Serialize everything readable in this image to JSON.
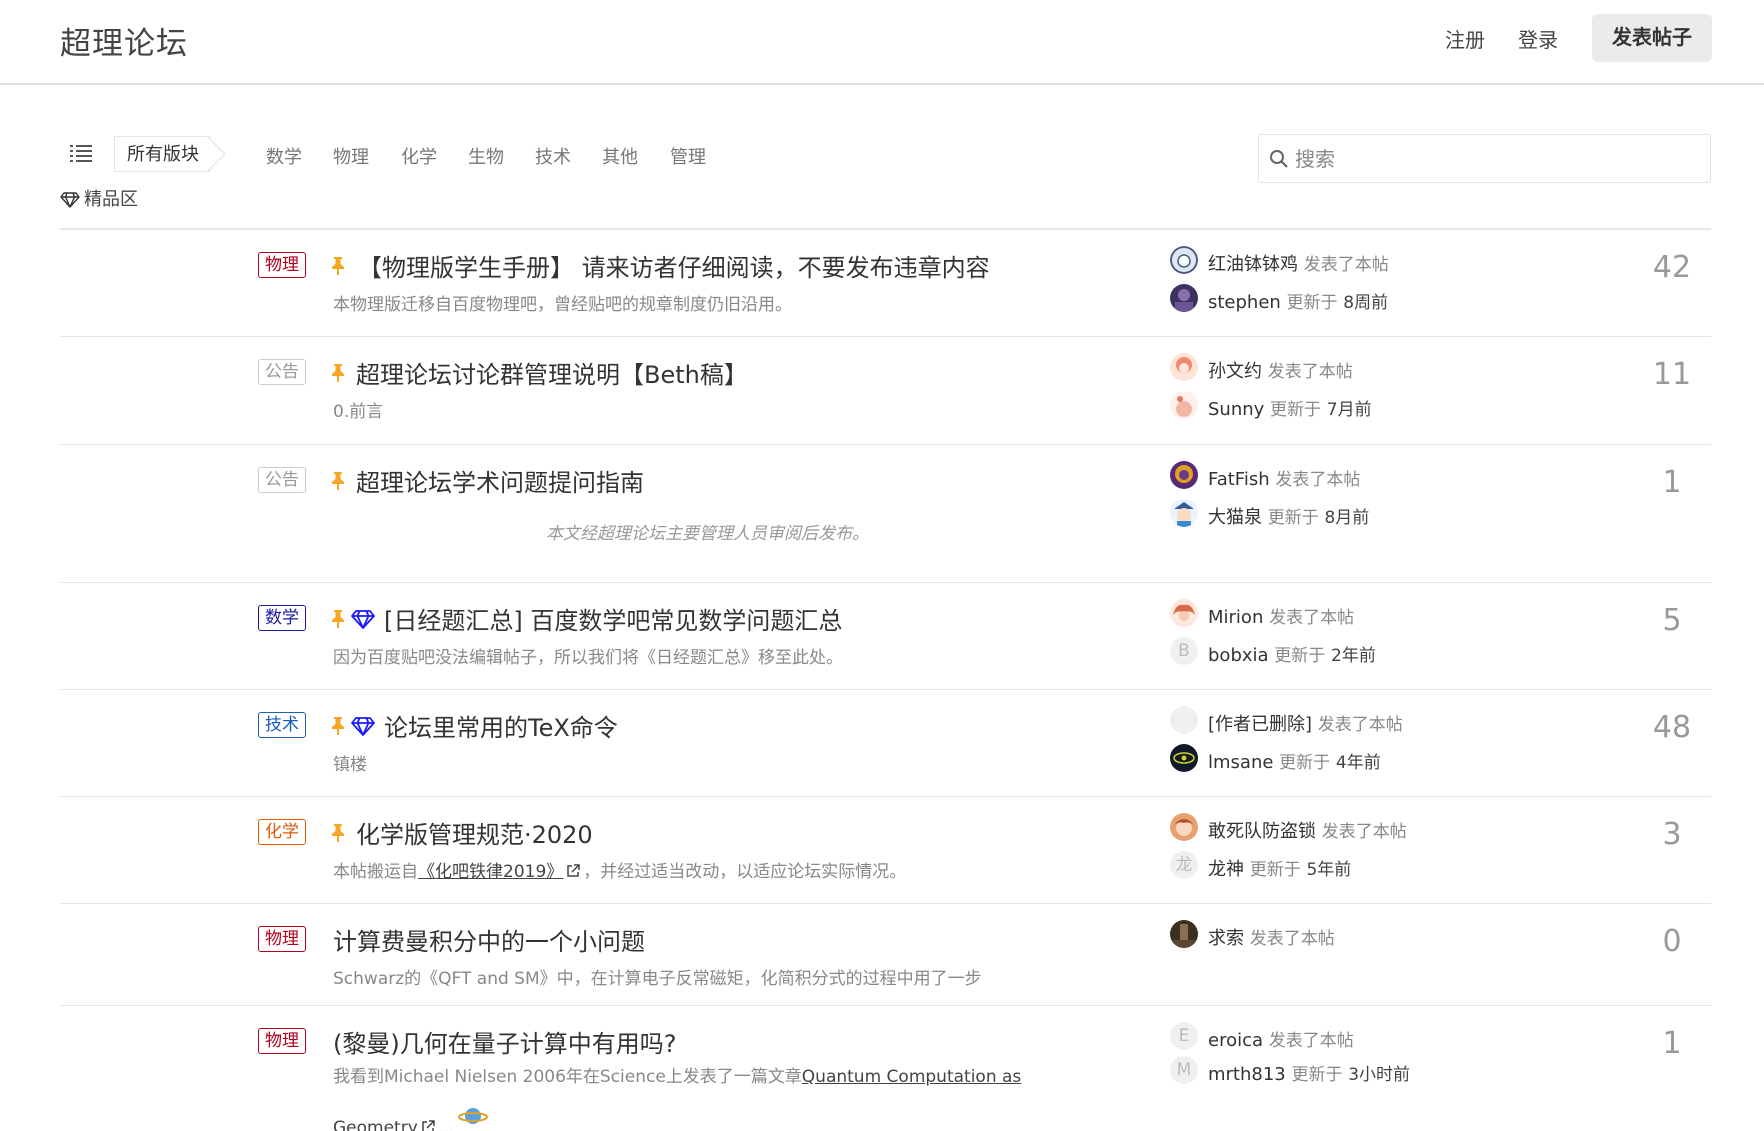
{
  "header": {
    "site_title": "超理论坛",
    "register": "注册",
    "login": "登录",
    "new_post": "发表帖子"
  },
  "filters": {
    "all_sections": "所有版块",
    "categories": [
      "数学",
      "物理",
      "化学",
      "生物",
      "技术",
      "其他",
      "管理"
    ],
    "featured": "精品区",
    "search_placeholder": "搜索"
  },
  "colors": {
    "physics": "#b3001b",
    "announce": "#999999",
    "math": "#1a1aa6",
    "tech": "#1a5fb4",
    "chemistry": "#e05a00",
    "pin": "#f5a623",
    "gem": "#1a1aff"
  },
  "topics": [
    {
      "badge": "物理",
      "pinned": true,
      "featured": false,
      "title": "【物理版学生手册】 请来访者仔细阅读，不要发布违章内容",
      "excerpt": "本物理版迁移自百度物理吧，曾经贴吧的规章制度仍旧沿用。",
      "author": "红油钵钵鸡",
      "author_action": "发表了本帖",
      "replier": "stephen",
      "reply_action": "更新于",
      "reply_time": "8周前",
      "count": "42"
    },
    {
      "badge": "公告",
      "pinned": true,
      "featured": false,
      "title": "超理论坛讨论群管理说明【Beth稿】",
      "excerpt": "0.前言",
      "author": "孙文约",
      "author_action": "发表了本帖",
      "replier": "Sunny",
      "reply_action": "更新于",
      "reply_time": "7月前",
      "count": "11"
    },
    {
      "badge": "公告",
      "pinned": true,
      "featured": false,
      "title": "超理论坛学术问题提问指南",
      "excerpt": "本文经超理论坛主要管理人员审阅后发布。",
      "author": "FatFish",
      "author_action": "发表了本帖",
      "replier": "大猫泉",
      "reply_action": "更新于",
      "reply_time": "8月前",
      "count": "1"
    },
    {
      "badge": "数学",
      "pinned": true,
      "featured": true,
      "title": "[日经题汇总] 百度数学吧常见数学问题汇总",
      "excerpt": "因为百度贴吧没法编辑帖子，所以我们将《日经题汇总》移至此处。",
      "author": "Mirion",
      "author_action": "发表了本帖",
      "replier": "bobxia",
      "replier_initial": "B",
      "reply_action": "更新于",
      "reply_time": "2年前",
      "count": "5"
    },
    {
      "badge": "技术",
      "pinned": true,
      "featured": true,
      "title": "论坛里常用的TeX命令",
      "excerpt": "镇楼",
      "author": "[作者已删除]",
      "author_action": "发表了本帖",
      "replier": "lmsane",
      "reply_action": "更新于",
      "reply_time": "4年前",
      "count": "48"
    },
    {
      "badge": "化学",
      "pinned": true,
      "featured": false,
      "title": "化学版管理规范·2020",
      "excerpt_pre": "本帖搬运自",
      "excerpt_link": "《化吧铁律2019》",
      "excerpt_post": "，并经过适当改动，以适应论坛实际情况。",
      "author": "敢死队防盗锁",
      "author_action": "发表了本帖",
      "replier": "龙神",
      "replier_initial": "龙",
      "reply_action": "更新于",
      "reply_time": "5年前",
      "count": "3"
    },
    {
      "badge": "物理",
      "pinned": false,
      "featured": false,
      "title": "计算费曼积分中的一个小问题",
      "excerpt": "Schwarz的《QFT and SM》中，在计算电子反常磁矩，化简积分式的过程中用了一步",
      "author": "求索",
      "author_action": "发表了本帖",
      "count": "0"
    },
    {
      "badge": "物理",
      "pinned": false,
      "featured": false,
      "title": "(黎曼)几何在量子计算中有用吗?",
      "excerpt_pre": "我看到Michael Nielsen 2006年在Science上发表了一篇文章",
      "excerpt_link": "Quantum Computation as",
      "excerpt_link2": "Geometry",
      "excerpt_post": "...",
      "author": "eroica",
      "author_initial": "E",
      "author_action": "发表了本帖",
      "replier": "mrth813",
      "replier_initial": "M",
      "reply_action": "更新于",
      "reply_time": "3小时前",
      "count": "1"
    }
  ]
}
